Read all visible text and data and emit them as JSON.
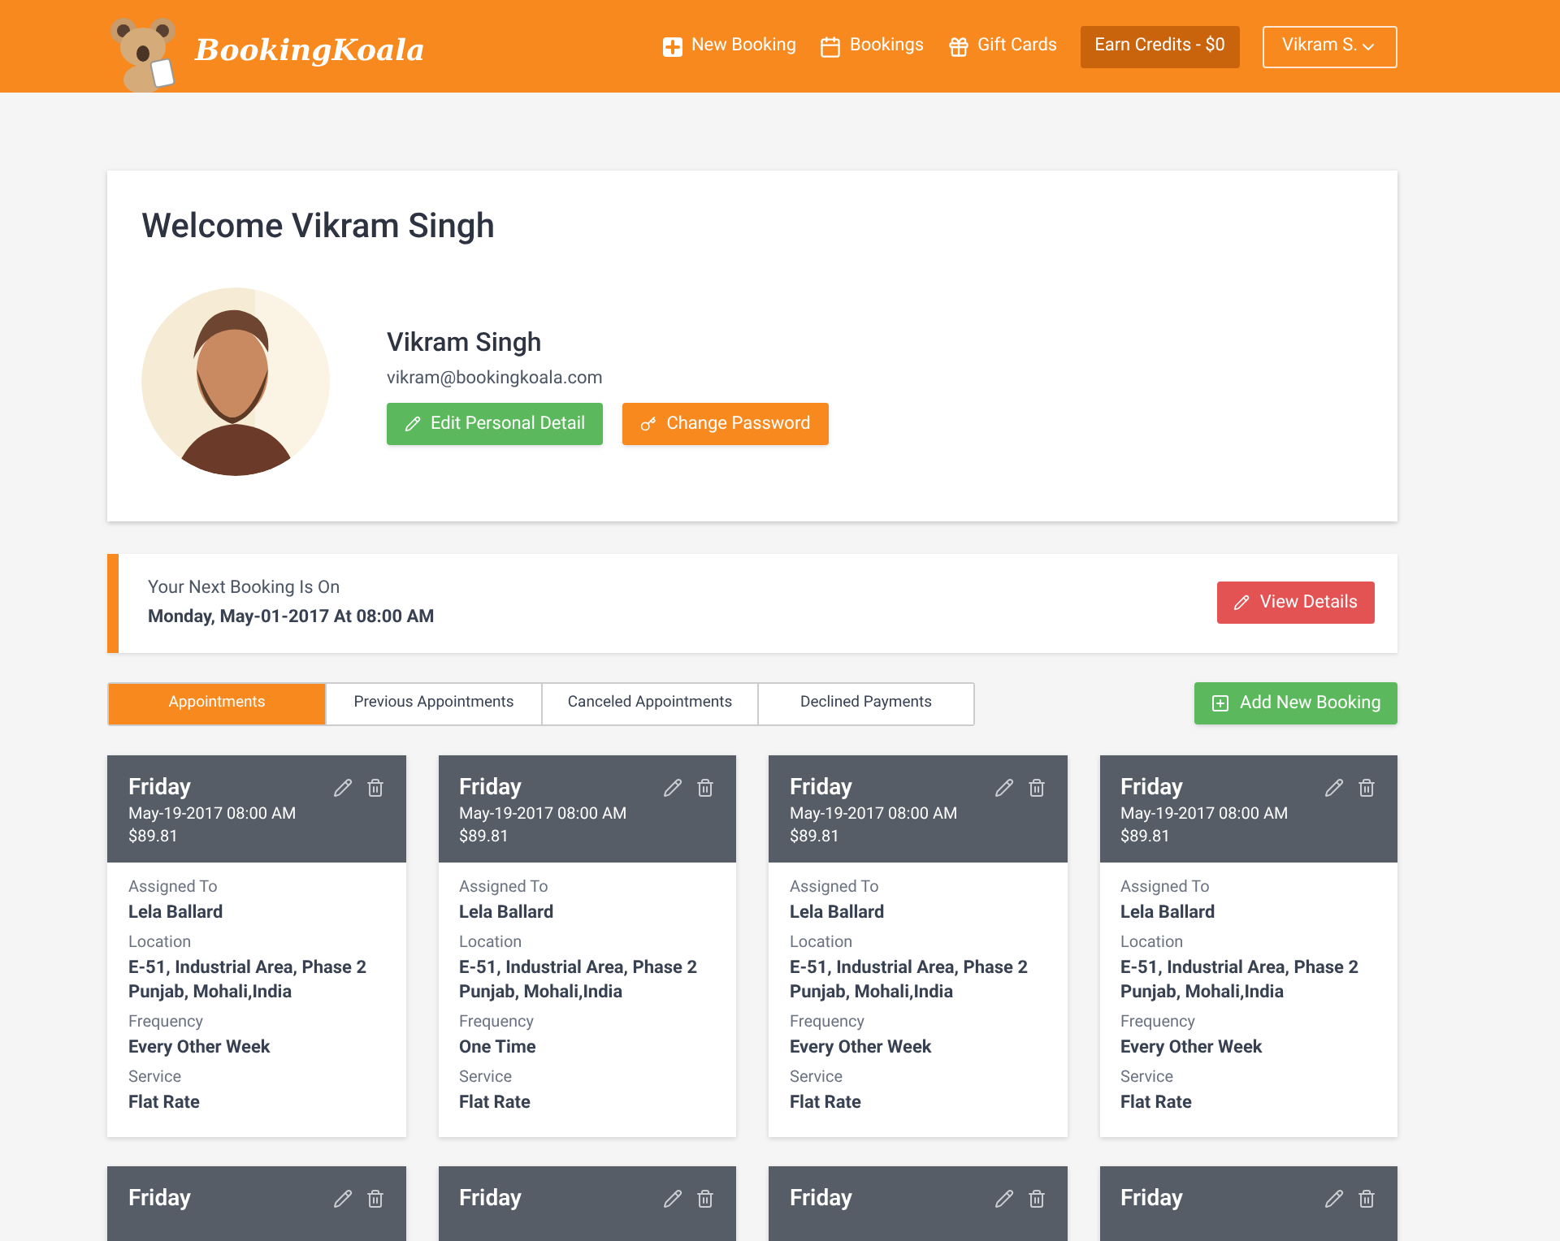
{
  "header": {
    "brand": "BookingKoala",
    "nav": [
      {
        "label": "New Booking"
      },
      {
        "label": "Bookings"
      },
      {
        "label": "Gift Cards"
      }
    ],
    "credits": "Earn Credits - $0",
    "user_menu": "Vikram S."
  },
  "profile": {
    "welcome": "Welcome Vikram Singh",
    "name": "Vikram Singh",
    "email": "vikram@bookingkoala.com",
    "buttons": [
      {
        "label": "Edit Personal Detail",
        "kind": "edit"
      },
      {
        "label": "Change Password",
        "kind": "password"
      }
    ]
  },
  "next_booking": {
    "label": "Your Next Booking Is On",
    "date": "Monday, May-01-2017 At 08:00 AM",
    "button": "View Details"
  },
  "tabs": [
    {
      "label": "Appointments",
      "selected": true
    },
    {
      "label": "Previous Appointments",
      "selected": false
    },
    {
      "label": "Canceled Appointments",
      "selected": false
    },
    {
      "label": "Declined Payments",
      "selected": false
    }
  ],
  "add_button": "Add New Booking",
  "cards": [
    {
      "day": "Friday",
      "datetime": "May-19-2017 08:00 AM",
      "price": "$89.81",
      "fields": [
        {
          "label": "Assigned To",
          "value": "Lela Ballard"
        },
        {
          "label": "Location",
          "value": "E-51, Industrial Area, Phase 2 Punjab, Mohali,India"
        },
        {
          "label": "Frequency",
          "value": "Every Other Week"
        },
        {
          "label": "Service",
          "value": "Flat Rate"
        }
      ]
    },
    {
      "day": "Friday",
      "datetime": "May-19-2017 08:00 AM",
      "price": "$89.81",
      "fields": [
        {
          "label": "Assigned To",
          "value": "Lela Ballard"
        },
        {
          "label": "Location",
          "value": "E-51, Industrial Area, Phase 2 Punjab, Mohali,India"
        },
        {
          "label": "Frequency",
          "value": "One Time"
        },
        {
          "label": "Service",
          "value": "Flat Rate"
        }
      ]
    },
    {
      "day": "Friday",
      "datetime": "May-19-2017 08:00 AM",
      "price": "$89.81",
      "fields": [
        {
          "label": "Assigned To",
          "value": "Lela Ballard"
        },
        {
          "label": "Location",
          "value": "E-51, Industrial Area, Phase 2 Punjab, Mohali,India"
        },
        {
          "label": "Frequency",
          "value": "Every Other Week"
        },
        {
          "label": "Service",
          "value": "Flat Rate"
        }
      ]
    },
    {
      "day": "Friday",
      "datetime": "May-19-2017 08:00 AM",
      "price": "$89.81",
      "fields": [
        {
          "label": "Assigned To",
          "value": "Lela Ballard"
        },
        {
          "label": "Location",
          "value": "E-51, Industrial Area, Phase 2 Punjab, Mohali,India"
        },
        {
          "label": "Frequency",
          "value": "Every Other Week"
        },
        {
          "label": "Service",
          "value": "Flat Rate"
        }
      ]
    },
    {
      "day": "Friday"
    },
    {
      "day": "Friday"
    },
    {
      "day": "Friday"
    },
    {
      "day": "Friday"
    }
  ]
}
